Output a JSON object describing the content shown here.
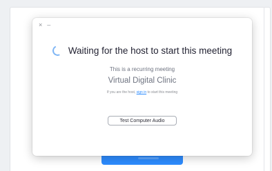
{
  "dialog": {
    "controls": {
      "close": "×",
      "minimize": "–"
    },
    "headline": "Waiting for the host to start this meeting",
    "recurring_note": "This is a recurring meeting",
    "meeting_name": "Virtual Digital Clinic",
    "host_prompt_before": "If you are the host, ",
    "host_prompt_link": "sign in",
    "host_prompt_after": " to start this meeting",
    "test_audio_label": "Test Computer Audio"
  },
  "colors": {
    "accent": "#2d8cff",
    "spinner": "#7fb6f5",
    "headline_text": "#232333",
    "muted_text": "#6e7380"
  },
  "icons": {
    "spinner": "loading-spinner-icon",
    "close": "close-icon",
    "minimize": "minimize-icon"
  }
}
